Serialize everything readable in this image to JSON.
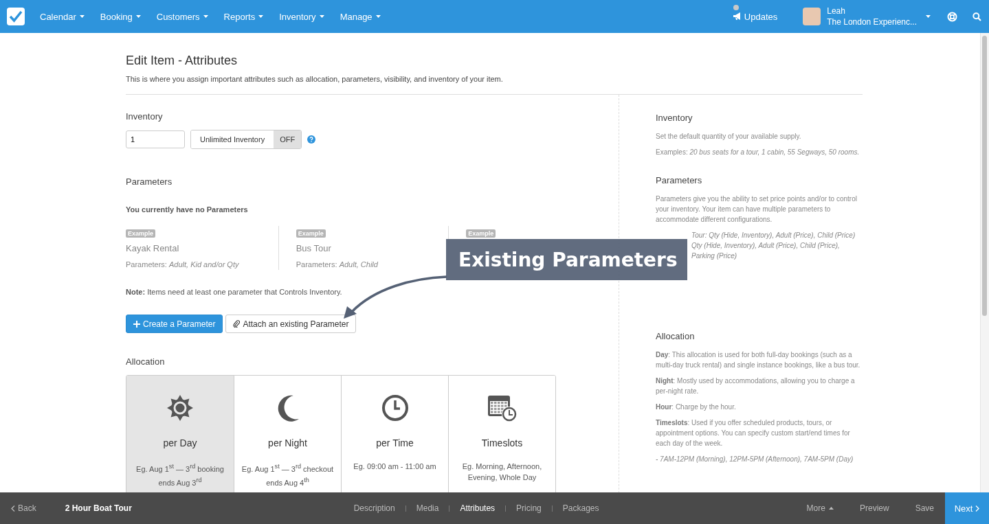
{
  "nav": {
    "menus": [
      "Calendar",
      "Booking",
      "Customers",
      "Reports",
      "Inventory",
      "Manage"
    ],
    "updates": "Updates",
    "user": {
      "name": "Leah",
      "account": "The London Experienc..."
    }
  },
  "page": {
    "title": "Edit Item - Attributes",
    "subtitle": "This is where you assign important attributes such as allocation, parameters, visibility, and inventory of your item."
  },
  "inventory": {
    "heading": "Inventory",
    "value": "1",
    "toggle": {
      "label": "Unlimited Inventory",
      "state_label": "OFF",
      "on": false
    }
  },
  "parameters": {
    "heading": "Parameters",
    "empty": "You currently have no Parameters",
    "examples": [
      {
        "badge": "Example",
        "title": "Kayak Rental",
        "params": "Parameters: *Adult, Kid and/or Qty*"
      },
      {
        "badge": "Example",
        "title": "Bus Tour",
        "params": "Parameters: *Adult, Child*"
      },
      {
        "badge": "Example"
      }
    ],
    "note": "**Note:** Items need at least one parameter that Controls Inventory.",
    "create_button": "Create a Parameter",
    "attach_button": "Attach an existing Parameter"
  },
  "allocation": {
    "heading": "Allocation",
    "options": [
      {
        "kind": "day",
        "label": "per Day",
        "example": "Eg. Aug 1$^{st}$ — 3$^{rd}$ booking ends Aug 3$^{rd}$",
        "selected": true
      },
      {
        "kind": "night",
        "label": "per Night",
        "example": "Eg. Aug 1$^{st}$ — 3$^{rd}$ checkout ends Aug 4$^{th}$",
        "selected": false
      },
      {
        "kind": "time",
        "label": "per Time",
        "example": "Eg. 09:00 am - 11:00 am",
        "selected": false
      },
      {
        "kind": "timeslots",
        "label": "Timeslots",
        "example": "Eg. Morning, Afternoon, Evening, Whole Day",
        "selected": false
      }
    ]
  },
  "help": [
    {
      "heading": "Inventory",
      "paragraphs": [
        "Set the default quantity of your available supply.",
        "Examples: *20 bus seats for a tour, 1 cabin, 55 Segways, 50 rooms.*"
      ]
    },
    {
      "heading": "Parameters",
      "paragraphs": [
        "Parameters give you the ability to set price points and/or to control your inventory. Your item can have multiple parameters to accommodate different configurations."
      ],
      "covered_lines": [
        "Tour: Qty (Hide, Inventory), Adult (Price), Child (Price)",
        "Qty (Hide, Inventory), Adult (Price), Child (Price),",
        "Parking (Price)"
      ]
    },
    {
      "heading": "Allocation",
      "paragraphs": [
        "**Day**: This allocation is used for both full-day bookings (such as a multi-day truck rental) and single instance bookings, like a bus tour.",
        "**Night**: Mostly used by accommodations, allowing you to charge a per-night rate.",
        "**Hour**: Charge by the hour.",
        "**Timeslots**: Used if you offer scheduled products, tours, or appointment options. You can specify custom start/end times for each day of the week.",
        "*- 7AM-12PM (Morning), 12PM-5PM (Afternoon), 7AM-5PM (Day)*"
      ]
    }
  ],
  "callout": {
    "text": "Existing Parameters"
  },
  "footer": {
    "back": "Back",
    "item_title": "2 Hour Boat Tour",
    "tabs": [
      {
        "label": "Description",
        "selected": false
      },
      {
        "label": "Media",
        "selected": false
      },
      {
        "label": "Attributes",
        "selected": true
      },
      {
        "label": "Pricing",
        "selected": false
      },
      {
        "label": "Packages",
        "selected": false
      }
    ],
    "more": "More",
    "preview": "Preview",
    "save": "Save",
    "next": "Next"
  }
}
